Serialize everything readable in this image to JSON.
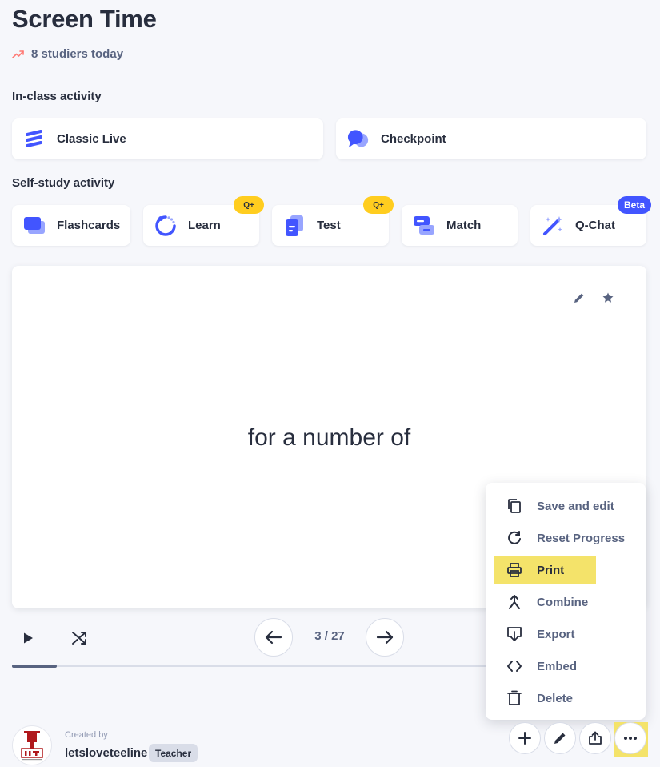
{
  "header": {
    "title": "Screen Time",
    "studiers": "8 studiers today"
  },
  "in_class": {
    "label": "In-class activity",
    "items": [
      {
        "label": "Classic Live",
        "icon": "classic-live-icon"
      },
      {
        "label": "Checkpoint",
        "icon": "checkpoint-icon"
      }
    ]
  },
  "self_study": {
    "label": "Self-study activity",
    "items": [
      {
        "label": "Flashcards",
        "icon": "flashcards-icon"
      },
      {
        "label": "Learn",
        "icon": "learn-icon",
        "badge": "Q+"
      },
      {
        "label": "Test",
        "icon": "test-icon",
        "badge": "Q+"
      },
      {
        "label": "Match",
        "icon": "match-icon"
      },
      {
        "label": "Q-Chat",
        "icon": "q-chat-icon",
        "badge": "Beta"
      }
    ]
  },
  "flashcard": {
    "term": "for a number of"
  },
  "controls": {
    "counter": "3 / 27",
    "progress_fraction": 0.07
  },
  "menu": {
    "items": [
      {
        "label": "Save and edit",
        "icon": "copy-icon"
      },
      {
        "label": "Reset Progress",
        "icon": "reset-icon"
      },
      {
        "label": "Print",
        "icon": "printer-icon",
        "highlighted": true
      },
      {
        "label": "Combine",
        "icon": "merge-icon"
      },
      {
        "label": "Export",
        "icon": "export-icon"
      },
      {
        "label": "Embed",
        "icon": "code-icon"
      },
      {
        "label": "Delete",
        "icon": "trash-icon"
      }
    ]
  },
  "creator": {
    "created_by_label": "Created by",
    "username": "letsloveteeline",
    "role_badge": "Teacher"
  },
  "colors": {
    "primary": "#4255ff",
    "badge_yellow": "#ffcd1f",
    "highlight": "#f4e36a",
    "text_dark": "#282e3e",
    "text_muted": "#586380",
    "background": "#f6f7fb"
  }
}
